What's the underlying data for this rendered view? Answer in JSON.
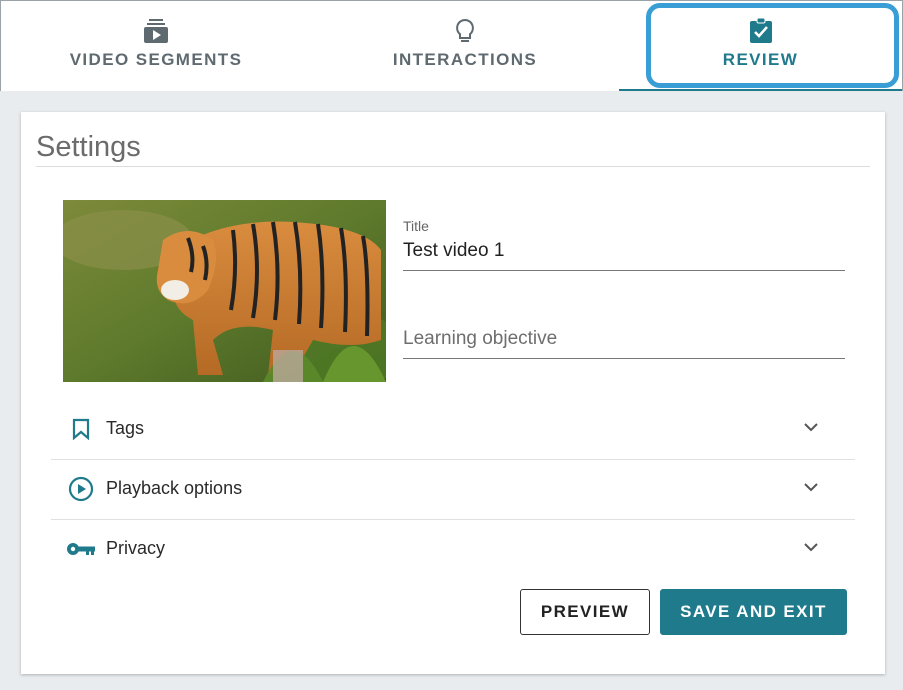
{
  "tabs": [
    {
      "label": "VIDEO SEGMENTS",
      "icon": "video-stack-icon"
    },
    {
      "label": "INTERACTIONS",
      "icon": "lightbulb-icon"
    },
    {
      "label": "REVIEW",
      "icon": "clipboard-check-icon",
      "active": true
    }
  ],
  "settings": {
    "title": "Settings",
    "thumbnail": "tiger-video-thumbnail",
    "title_field": {
      "label": "Title",
      "value": "Test video 1"
    },
    "objective_field": {
      "placeholder": "Learning objective"
    }
  },
  "accordions": [
    {
      "label": "Tags",
      "icon": "bookmark-icon"
    },
    {
      "label": "Playback options",
      "icon": "play-circle-icon"
    },
    {
      "label": "Privacy",
      "icon": "key-icon"
    }
  ],
  "buttons": {
    "preview": "PREVIEW",
    "save": "SAVE AND EXIT"
  },
  "colors": {
    "accent": "#1f7a8c",
    "highlight": "#3a9ed6"
  }
}
